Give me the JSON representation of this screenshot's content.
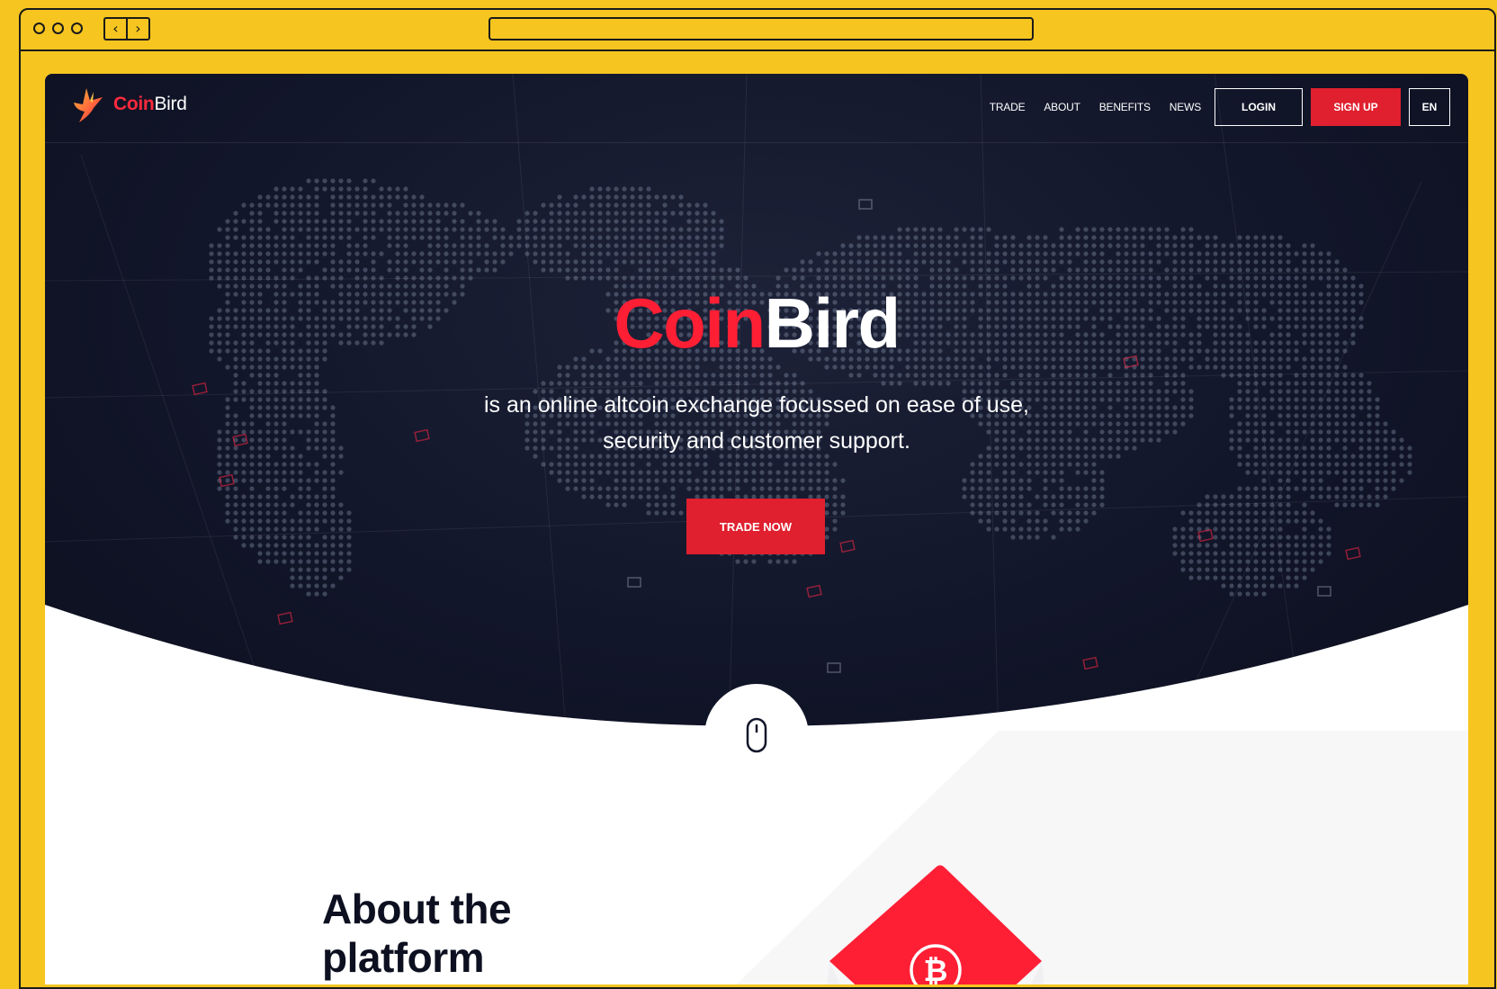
{
  "brand": {
    "coin": "Coin",
    "bird": "Bird",
    "accent_color": "#e0202f",
    "dark_color": "#12162a"
  },
  "nav": {
    "links": [
      "TRADE",
      "ABOUT",
      "BENEFITS",
      "NEWS"
    ],
    "login_label": "LOGIN",
    "signup_label": "SIGN UP",
    "language_label": "EN"
  },
  "hero": {
    "title_part1": "Coin",
    "title_part2": "Bird",
    "subtitle_line1": "is an online altcoin exchange focussed on ease of use,",
    "subtitle_line2": "security and customer support.",
    "cta_label": "TRADE NOW"
  },
  "scroll_indicator": {
    "icon": "mouse-icon"
  },
  "about": {
    "title_line1": "About the",
    "title_line2": "platform",
    "icon": "bitcoin-icon"
  }
}
